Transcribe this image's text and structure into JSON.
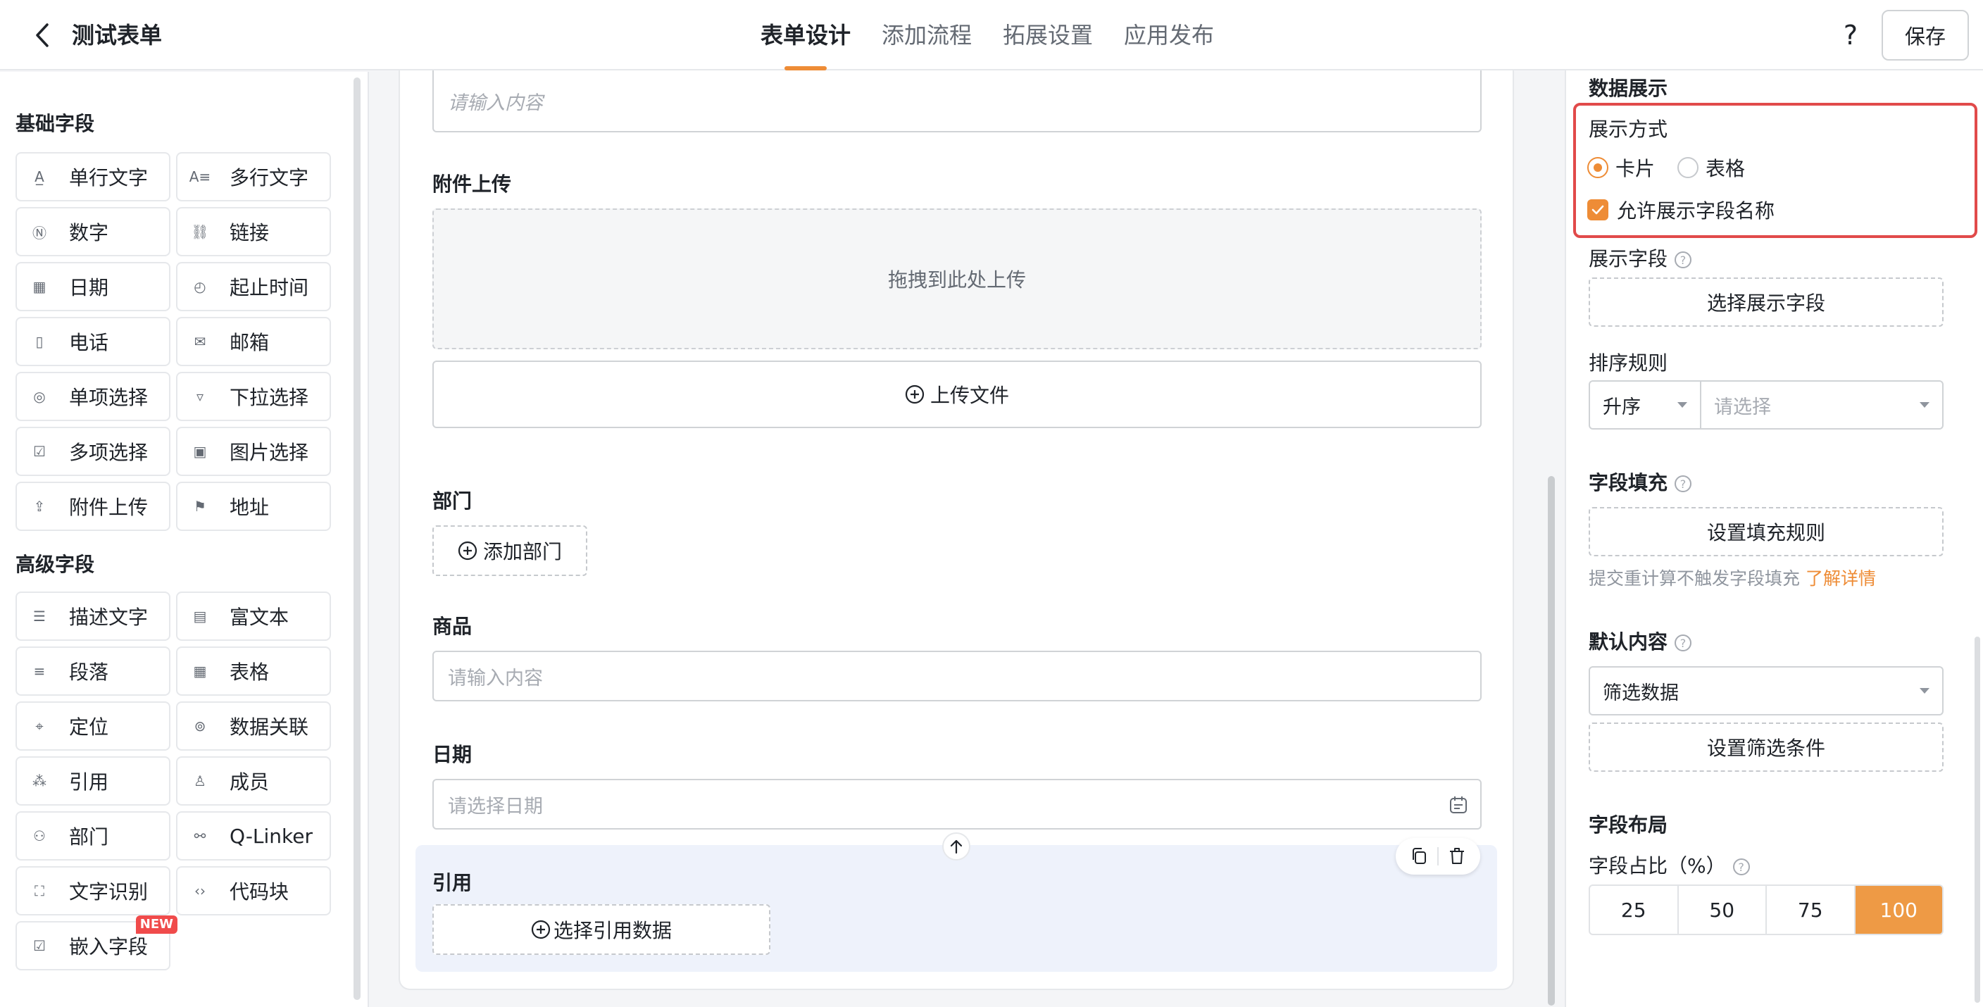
{
  "header": {
    "title": "测试表单",
    "tabs": [
      {
        "label": "表单设计",
        "active": true
      },
      {
        "label": "添加流程",
        "active": false
      },
      {
        "label": "拓展设置",
        "active": false
      },
      {
        "label": "应用发布",
        "active": false
      }
    ],
    "help": "?",
    "save_label": "保存"
  },
  "sidebar": {
    "basic_title": "基础字段",
    "basic_fields": [
      {
        "label": "单行文字",
        "icon": "text-a-icon"
      },
      {
        "label": "多行文字",
        "icon": "text-multiline-icon"
      },
      {
        "label": "数字",
        "icon": "number-icon"
      },
      {
        "label": "链接",
        "icon": "link-icon"
      },
      {
        "label": "日期",
        "icon": "calendar-icon"
      },
      {
        "label": "起止时间",
        "icon": "time-range-icon"
      },
      {
        "label": "电话",
        "icon": "phone-icon"
      },
      {
        "label": "邮箱",
        "icon": "mail-icon"
      },
      {
        "label": "单项选择",
        "icon": "radio-icon"
      },
      {
        "label": "下拉选择",
        "icon": "dropdown-icon"
      },
      {
        "label": "多项选择",
        "icon": "checkbox-icon"
      },
      {
        "label": "图片选择",
        "icon": "image-icon"
      },
      {
        "label": "附件上传",
        "icon": "upload-icon"
      },
      {
        "label": "地址",
        "icon": "address-icon"
      }
    ],
    "advanced_title": "高级字段",
    "advanced_fields": [
      {
        "label": "描述文字",
        "icon": "description-icon"
      },
      {
        "label": "富文本",
        "icon": "rich-text-icon"
      },
      {
        "label": "段落",
        "icon": "paragraph-icon"
      },
      {
        "label": "表格",
        "icon": "table-icon"
      },
      {
        "label": "定位",
        "icon": "location-icon"
      },
      {
        "label": "数据关联",
        "icon": "data-link-icon"
      },
      {
        "label": "引用",
        "icon": "reference-icon"
      },
      {
        "label": "成员",
        "icon": "member-icon"
      },
      {
        "label": "部门",
        "icon": "department-icon"
      },
      {
        "label": "Q-Linker",
        "icon": "q-linker-icon"
      },
      {
        "label": "文字识别",
        "icon": "ocr-icon"
      },
      {
        "label": "代码块",
        "icon": "code-icon"
      },
      {
        "label": "嵌入字段",
        "icon": "embed-icon",
        "badge": "NEW"
      }
    ]
  },
  "canvas": {
    "top_input_placeholder": "请输入内容",
    "attachment": {
      "label": "附件上传",
      "drop_text": "拖拽到此处上传",
      "upload_button": "上传文件"
    },
    "department": {
      "label": "部门",
      "add_button": "添加部门"
    },
    "product": {
      "label": "商品",
      "placeholder": "请输入内容"
    },
    "date": {
      "label": "日期",
      "placeholder": "请选择日期"
    },
    "reference": {
      "label": "引用",
      "button": "选择引用数据"
    }
  },
  "properties": {
    "data_display_title": "数据展示",
    "display_mode_label": "展示方式",
    "display_modes": [
      {
        "label": "卡片",
        "checked": true
      },
      {
        "label": "表格",
        "checked": false
      }
    ],
    "allow_field_name_label": "允许展示字段名称",
    "allow_field_name_checked": true,
    "display_fields_label": "展示字段",
    "select_display_fields_button": "选择展示字段",
    "sort_label": "排序规则",
    "sort_order_value": "升序",
    "sort_field_placeholder": "请选择",
    "field_fill_title": "字段填充",
    "fill_rule_button": "设置填充规则",
    "fill_hint": "提交重计算不触发字段填充",
    "fill_hint_link": "了解详情",
    "default_content_title": "默认内容",
    "default_content_value": "筛选数据",
    "filter_condition_button": "设置筛选条件",
    "layout_title": "字段布局",
    "ratio_label": "字段占比（%）",
    "ratio_options": [
      "25",
      "50",
      "75",
      "100"
    ],
    "ratio_selected": "100"
  },
  "colors": {
    "accent": "#ee8c36",
    "highlight_border": "#e14a4a",
    "selected_block_bg": "#eef2fb"
  }
}
